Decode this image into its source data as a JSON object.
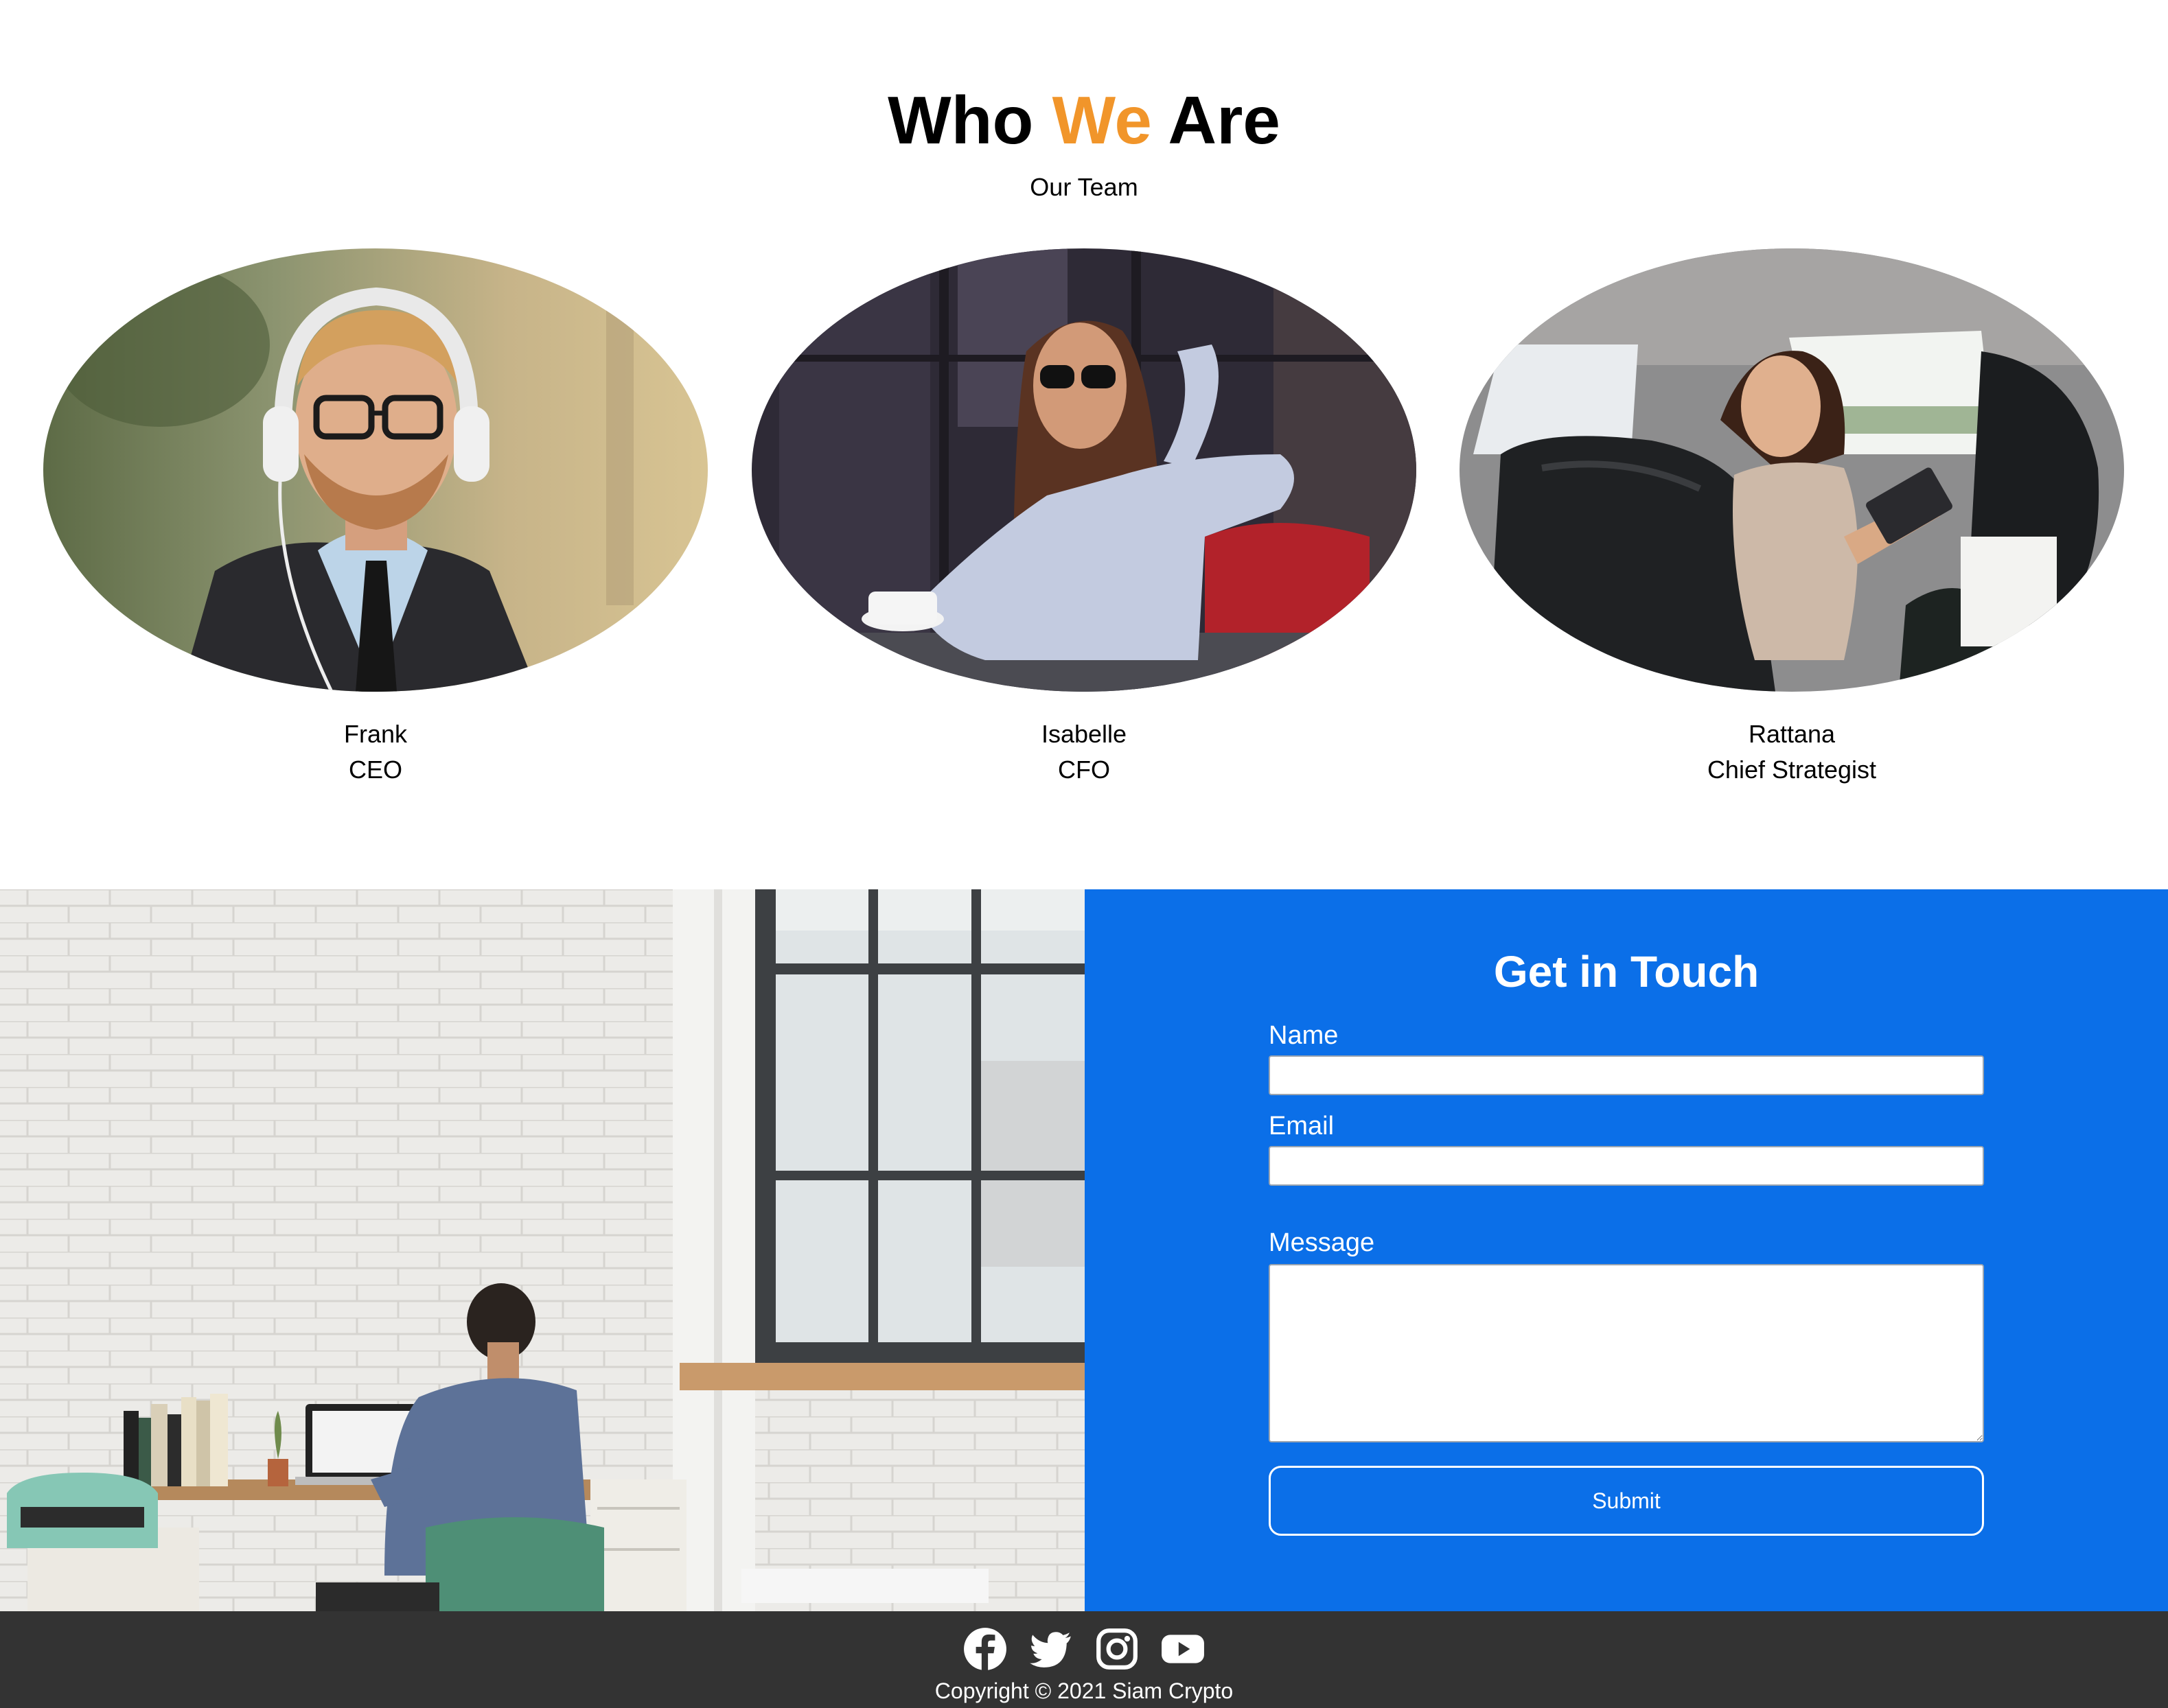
{
  "team": {
    "title_part1": "Who ",
    "title_accent": "We",
    "title_part2": " Are",
    "subtitle": "Our Team",
    "accent_color": "#f1952a",
    "members": [
      {
        "name": "Frank",
        "role": "CEO"
      },
      {
        "name": "Isabelle",
        "role": "CFO"
      },
      {
        "name": "Rattana",
        "role": "Chief Strategist"
      }
    ]
  },
  "contact": {
    "title": "Get in Touch",
    "panel_color": "#0b6fe8",
    "name_label": "Name",
    "name_value": "",
    "email_label": "Email",
    "email_value": "",
    "message_label": "Message",
    "message_value": "",
    "submit_label": "Submit"
  },
  "footer": {
    "social_icons": [
      "facebook-icon",
      "twitter-icon",
      "instagram-icon",
      "youtube-icon"
    ],
    "copyright": "Copyright © 2021 Siam Crypto",
    "background_color": "#333333"
  }
}
